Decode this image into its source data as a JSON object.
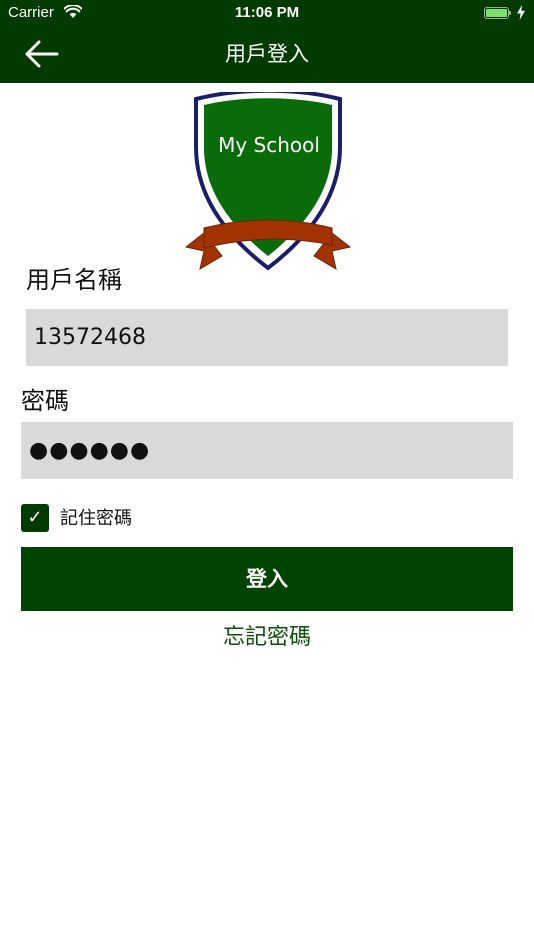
{
  "status_bar": {
    "carrier": "Carrier",
    "time": "11:06 PM"
  },
  "nav": {
    "title": "用戶登入",
    "back_icon": "arrow-left-icon"
  },
  "logo": {
    "text": "My School"
  },
  "form": {
    "username_label": "用戶名稱",
    "username_value": "13572468",
    "password_label": "密碼",
    "password_masked": "●●●●●●",
    "remember_label": "記住密碼",
    "remember_checked": true,
    "login_label": "登入",
    "forgot_label": "忘記密碼"
  },
  "colors": {
    "header": "#013b00",
    "button": "#014401",
    "input_bg": "#d9d9d9",
    "shield_green": "#0a6b0a",
    "ribbon": "#a03300",
    "link": "#0b4f0b"
  }
}
